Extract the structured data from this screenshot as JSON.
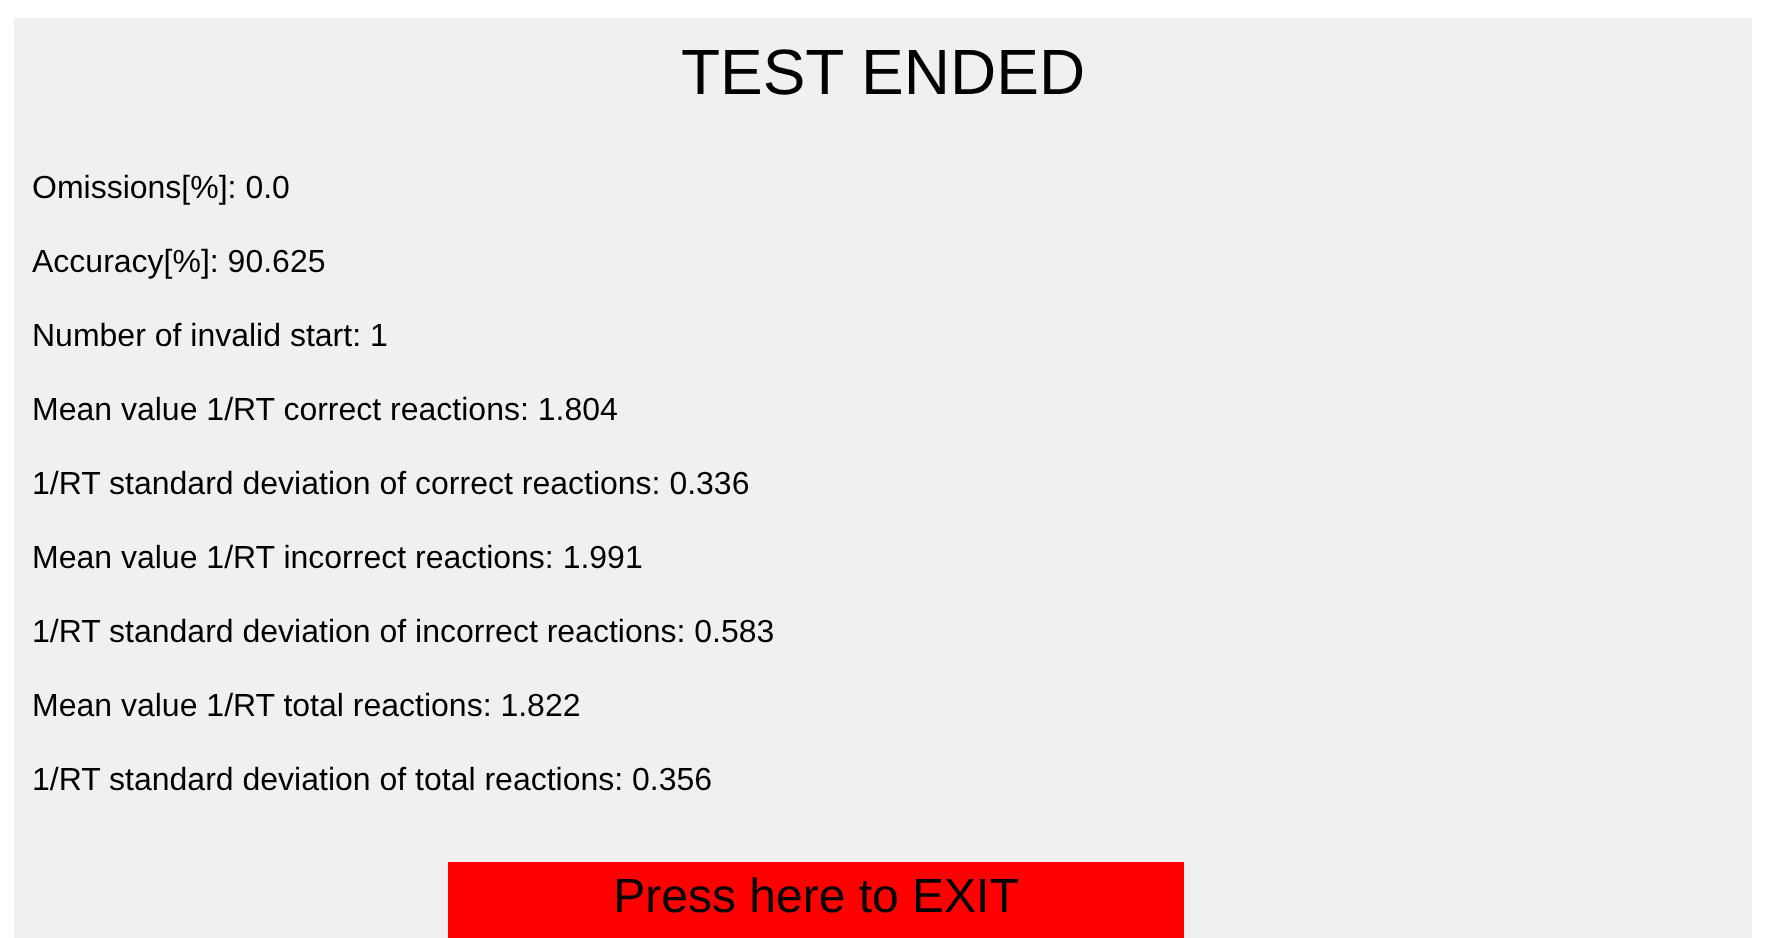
{
  "title": "TEST ENDED",
  "results": [
    "Omissions[%]: 0.0",
    "Accuracy[%]: 90.625",
    "Number of invalid start: 1",
    "Mean value 1/RT correct reactions: 1.804",
    "1/RT standard deviation of correct reactions: 0.336",
    "Mean value 1/RT incorrect reactions: 1.991",
    "1/RT standard deviation of incorrect reactions: 0.583",
    "Mean value 1/RT total reactions: 1.822",
    "1/RT standard deviation of total reactions: 0.356"
  ],
  "exit_button": "Press here to EXIT"
}
